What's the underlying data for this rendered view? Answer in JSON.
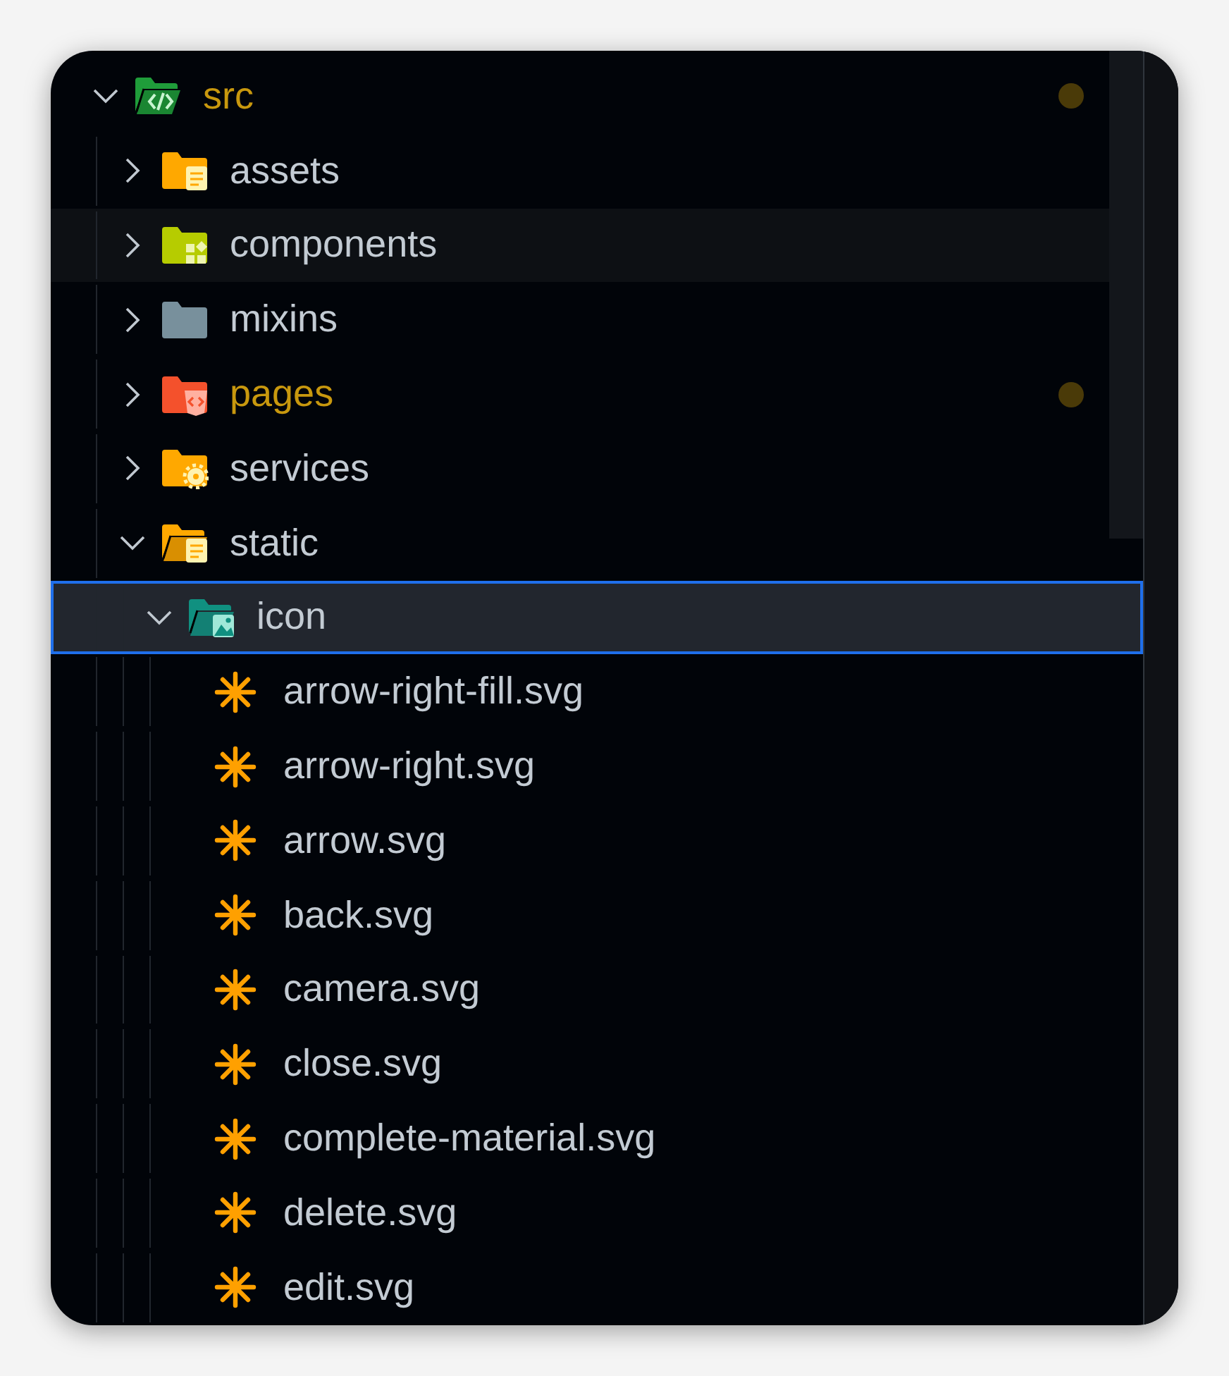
{
  "tree": [
    {
      "label": "src",
      "kind": "source",
      "expanded": true,
      "modified": true,
      "selected": false,
      "hovered": false,
      "children": [
        {
          "label": "assets",
          "kind": "assets",
          "expanded": false,
          "modified": false,
          "selected": false,
          "hovered": false
        },
        {
          "label": "components",
          "kind": "components",
          "expanded": false,
          "modified": false,
          "selected": false,
          "hovered": true
        },
        {
          "label": "mixins",
          "kind": "plain",
          "expanded": false,
          "modified": false,
          "selected": false,
          "hovered": false
        },
        {
          "label": "pages",
          "kind": "pages",
          "expanded": false,
          "modified": true,
          "selected": false,
          "hovered": false
        },
        {
          "label": "services",
          "kind": "services",
          "expanded": false,
          "modified": false,
          "selected": false,
          "hovered": false
        },
        {
          "label": "static",
          "kind": "static",
          "expanded": true,
          "modified": false,
          "selected": false,
          "hovered": false,
          "children": [
            {
              "label": "icon",
              "kind": "images",
              "expanded": true,
              "modified": false,
              "selected": true,
              "hovered": false,
              "children": [
                {
                  "label": "arrow-right-fill.svg",
                  "kind": "svg",
                  "modified": false,
                  "selected": false,
                  "hovered": false
                },
                {
                  "label": "arrow-right.svg",
                  "kind": "svg",
                  "modified": false,
                  "selected": false,
                  "hovered": false
                },
                {
                  "label": "arrow.svg",
                  "kind": "svg",
                  "modified": false,
                  "selected": false,
                  "hovered": false
                },
                {
                  "label": "back.svg",
                  "kind": "svg",
                  "modified": false,
                  "selected": false,
                  "hovered": false
                },
                {
                  "label": "camera.svg",
                  "kind": "svg",
                  "modified": false,
                  "selected": false,
                  "hovered": false
                },
                {
                  "label": "close.svg",
                  "kind": "svg",
                  "modified": false,
                  "selected": false,
                  "hovered": false
                },
                {
                  "label": "complete-material.svg",
                  "kind": "svg",
                  "modified": false,
                  "selected": false,
                  "hovered": false
                },
                {
                  "label": "delete.svg",
                  "kind": "svg",
                  "modified": false,
                  "selected": false,
                  "hovered": false
                },
                {
                  "label": "edit.svg",
                  "kind": "svg",
                  "modified": false,
                  "selected": false,
                  "hovered": false
                }
              ]
            }
          ]
        }
      ]
    }
  ]
}
